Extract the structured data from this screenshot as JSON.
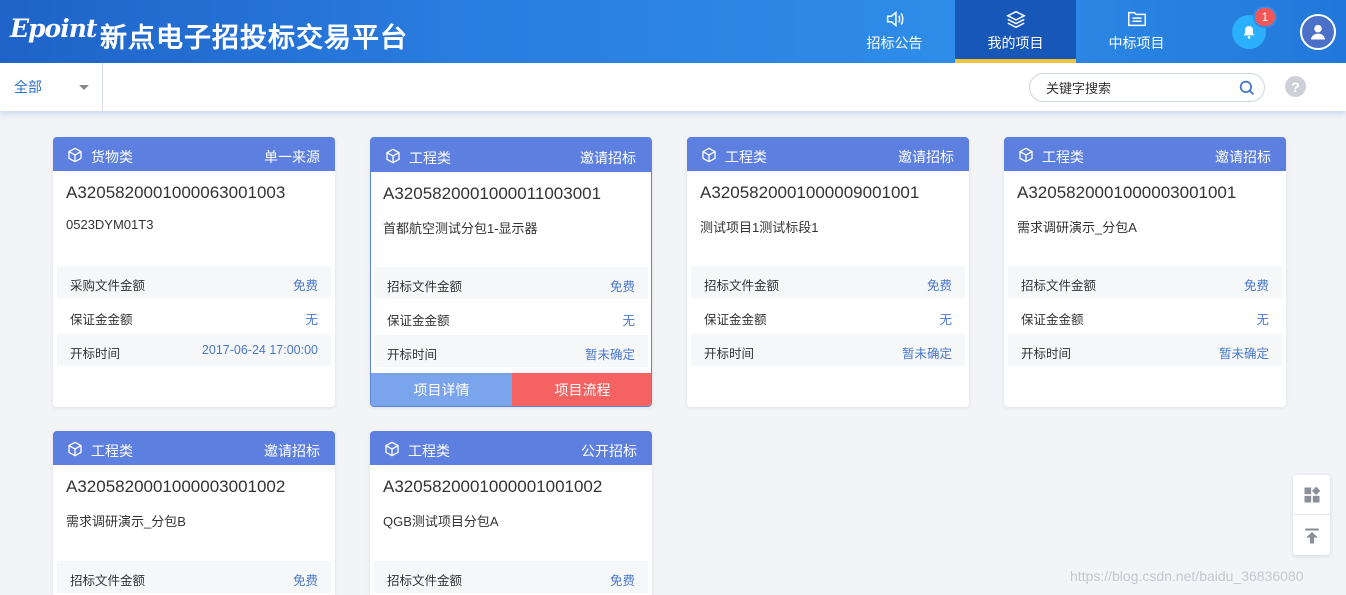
{
  "header": {
    "logo": "Epoint",
    "title": "新点电子招投标交易平台",
    "nav": [
      {
        "label": "招标公告",
        "icon": "speaker-icon",
        "active": false
      },
      {
        "label": "我的项目",
        "icon": "layers-icon",
        "active": true
      },
      {
        "label": "中标项目",
        "icon": "folder-icon",
        "active": false
      }
    ],
    "notification_count": "1"
  },
  "toolbar": {
    "filter_value": "全部",
    "search_placeholder": "关键字搜索",
    "help_label": "?"
  },
  "cards": [
    {
      "category": "货物类",
      "mode": "单一来源",
      "code": "A320582000100006300100З",
      "name": "0523DYM01T3",
      "rows": [
        {
          "k": "采购文件金额",
          "v": "免费"
        },
        {
          "k": "保证金金额",
          "v": "无"
        },
        {
          "k": "开标时间",
          "v": "2017-06-24 17:00:00"
        }
      ]
    },
    {
      "category": "工程类",
      "mode": "邀请招标",
      "code": "A320582000100001100З001",
      "name": "首都航空测试分包1-显示器",
      "rows": [
        {
          "k": "招标文件金额",
          "v": "免费"
        },
        {
          "k": "保证金金额",
          "v": "无"
        },
        {
          "k": "开标时间",
          "v": "暂未确定"
        }
      ],
      "actions": {
        "detail": "项目详情",
        "flow": "项目流程"
      }
    },
    {
      "category": "工程类",
      "mode": "邀请招标",
      "code": "A320582000100000900100 1",
      "name": "测试项目1测试标段1",
      "rows": [
        {
          "k": "招标文件金额",
          "v": "免费"
        },
        {
          "k": "保证金金额",
          "v": "无"
        },
        {
          "k": "开标时间",
          "v": "暂未确定"
        }
      ]
    },
    {
      "category": "工程类",
      "mode": "邀请招标",
      "code": "A3205820001000003001001",
      "name": "需求调研演示_分包A",
      "rows": [
        {
          "k": "招标文件金额",
          "v": "免费"
        },
        {
          "k": "保证金金额",
          "v": "无"
        },
        {
          "k": "开标时间",
          "v": "暂未确定"
        }
      ]
    },
    {
      "category": "工程类",
      "mode": "邀请招标",
      "code": "A3205820001000003001002",
      "name": "需求调研演示_分包B",
      "rows": [
        {
          "k": "招标文件金额",
          "v": "免费"
        }
      ]
    },
    {
      "category": "工程类",
      "mode": "公开招标",
      "code": "A3205820001000001001002",
      "name": "QGB测试项目分包A",
      "rows": [
        {
          "k": "招标文件金额",
          "v": "免费"
        }
      ]
    }
  ],
  "watermark": "https://blog.csdn.net/baidu_36836080"
}
